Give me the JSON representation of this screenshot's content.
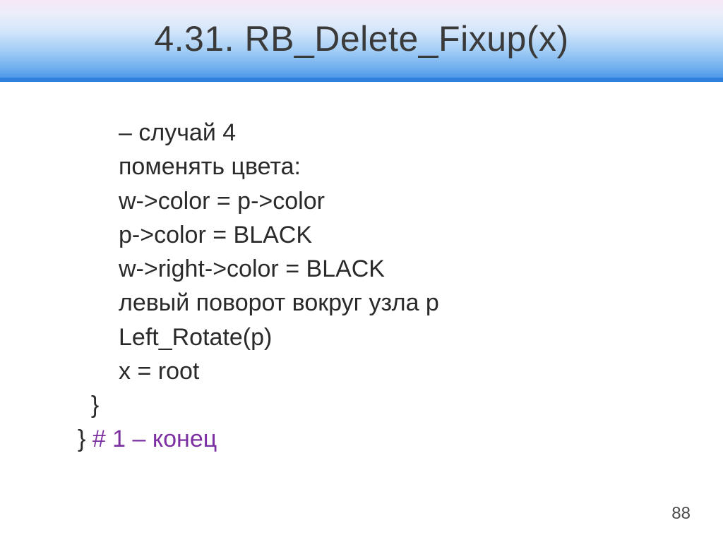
{
  "slide": {
    "title": "4.31. RB_Delete_Fixup(x)",
    "page_number": "88",
    "lines": [
      {
        "text": "– случай 4",
        "indent": 1
      },
      {
        "text": "поменять цвета:",
        "indent": 1
      },
      {
        "text": "w->color = p->color",
        "indent": 1
      },
      {
        "text": "p->color = BLACK",
        "indent": 1
      },
      {
        "text": "w->right->color = BLACK",
        "indent": 1
      },
      {
        "text": "левый поворот вокруг узла p",
        "indent": 1
      },
      {
        "text": "Left_Rotate(p)",
        "indent": 1
      },
      {
        "text": "x = root",
        "indent": 1
      },
      {
        "text": "}",
        "indent": 0,
        "pad": "  "
      }
    ],
    "last_line": {
      "brace": "} ",
      "comment": "# 1 – конец"
    }
  }
}
